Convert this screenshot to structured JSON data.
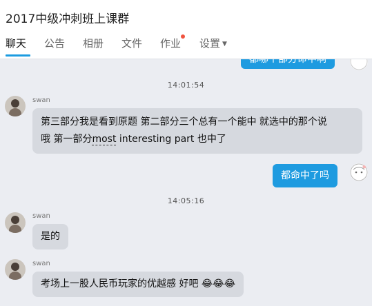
{
  "window": {
    "title": "2017中级冲刺班上课群"
  },
  "tabs": [
    {
      "label": "聊天"
    },
    {
      "label": "公告"
    },
    {
      "label": "相册"
    },
    {
      "label": "文件"
    },
    {
      "label": "作业"
    },
    {
      "label": "设置"
    }
  ],
  "messages": {
    "top_partial": "都哪个部分命中啊",
    "time1": "14:01:54",
    "m1": {
      "sender": "swan",
      "line1": "第三部分我是看到原题 第二部分三个总有一个能中 就选中的那个说",
      "line2_a": "哦 第一部分",
      "line2_b": "most",
      "line2_c": " interesting part 也中了"
    },
    "self1": "都命中了吗",
    "time2": "14:05:16",
    "m2": {
      "sender": "swan",
      "text": "是的"
    },
    "m3": {
      "sender": "swan",
      "text": "考场上一股人民币玩家的优越感 好吧",
      "emoji": "😂😂😂"
    }
  },
  "colors": {
    "accent": "#1e9be0",
    "bubble_other": "#d6d9df",
    "background": "#ebedf2",
    "badge": "#f0533f"
  }
}
